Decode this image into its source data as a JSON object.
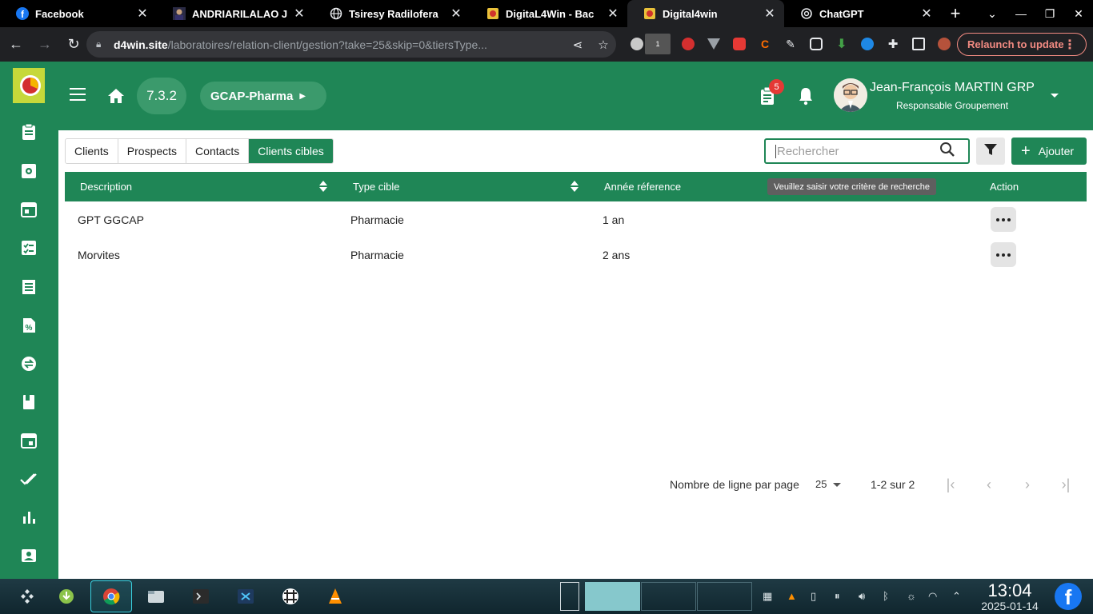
{
  "browser": {
    "tabs": [
      {
        "title": "Facebook",
        "icon": "facebook-icon"
      },
      {
        "title": "ANDRIARILALAO J",
        "icon": "profile-photo-icon"
      },
      {
        "title": "Tsiresy Radiloferа",
        "icon": "globe-icon"
      },
      {
        "title": "DigitaL4Win - Bac",
        "icon": "d4win-icon"
      },
      {
        "title": "Digital4win",
        "icon": "d4win-icon",
        "active": true
      },
      {
        "title": "ChatGPT",
        "icon": "chatgpt-icon"
      }
    ],
    "url_domain": "d4win.site",
    "url_path": "/laboratoires/relation-client/gestion?take=25&skip=0&tiersType...",
    "relaunch_label": "Relaunch to update",
    "extension_badge": "1"
  },
  "header": {
    "version": "7.3.2",
    "organization": "GCAP-Pharma",
    "notification_count": "5",
    "user_name": "Jean-François MARTIN GRP",
    "user_role": "Responsable Groupement"
  },
  "tabs": [
    "Clients",
    "Prospects",
    "Contacts",
    "Clients cibles"
  ],
  "active_tab": "Clients cibles",
  "search": {
    "placeholder": "Rechercher",
    "tooltip": "Veuillez saisir votre critère de recherche"
  },
  "add_label": "Ajouter",
  "table": {
    "columns": [
      "Description",
      "Type cible",
      "Année réference",
      "Action"
    ],
    "rows": [
      {
        "description": "GPT GGCAP",
        "type": "Pharmacie",
        "annee": "1 an"
      },
      {
        "description": "Morvites",
        "type": "Pharmacie",
        "annee": "2 ans"
      }
    ]
  },
  "pagination": {
    "rows_per_page_label": "Nombre de ligne par page",
    "rows_per_page": "25",
    "range": "1-2 sur 2"
  },
  "taskbar": {
    "time": "13:04",
    "date": "2025-01-14"
  },
  "colors": {
    "primary": "#1f8656",
    "badge": "#e53935",
    "relaunch": "#f28b82"
  }
}
